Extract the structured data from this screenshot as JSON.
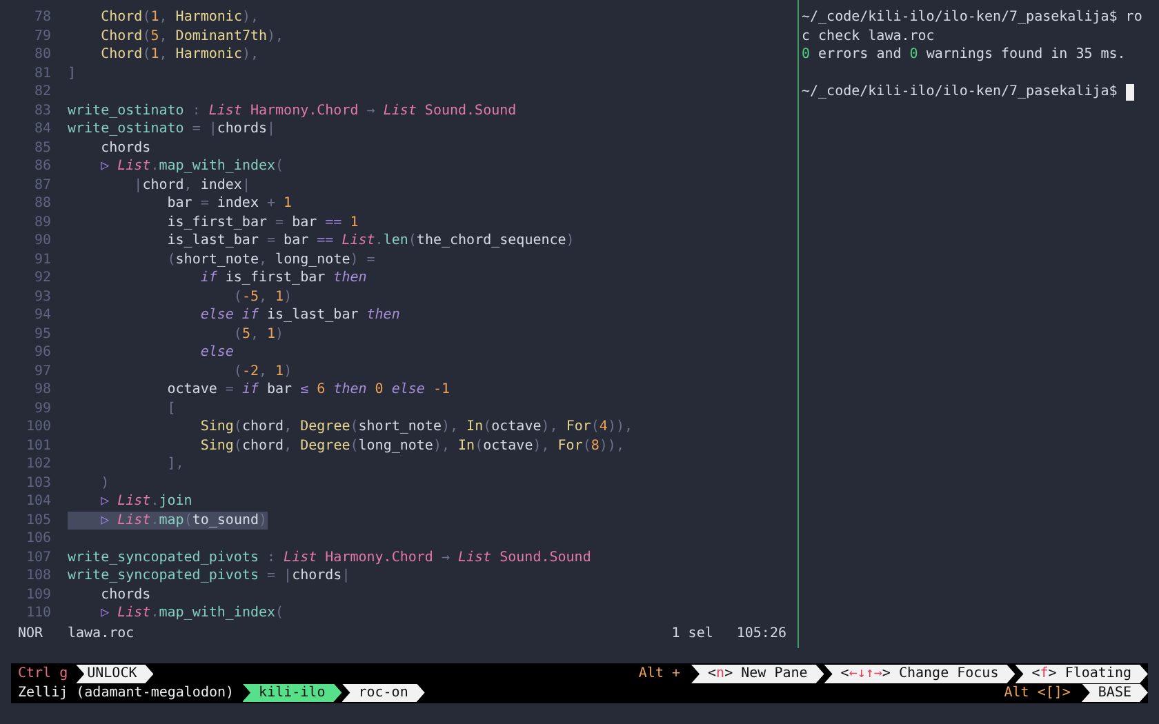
{
  "editor": {
    "lines": [
      {
        "number": "78",
        "selected": false,
        "tokens": [
          {
            "text": "    Chord",
            "kind": "c"
          },
          {
            "text": "(",
            "kind": "x"
          },
          {
            "text": "1",
            "kind": "n"
          },
          {
            "text": ", ",
            "kind": "x"
          },
          {
            "text": "Harmonic",
            "kind": "c"
          },
          {
            "text": "),",
            "kind": "x"
          }
        ]
      },
      {
        "number": "79",
        "selected": false,
        "tokens": [
          {
            "text": "    Chord",
            "kind": "c"
          },
          {
            "text": "(",
            "kind": "x"
          },
          {
            "text": "5",
            "kind": "n"
          },
          {
            "text": ", ",
            "kind": "x"
          },
          {
            "text": "Dominant7th",
            "kind": "c"
          },
          {
            "text": "),",
            "kind": "x"
          }
        ]
      },
      {
        "number": "80",
        "selected": false,
        "tokens": [
          {
            "text": "    Chord",
            "kind": "c"
          },
          {
            "text": "(",
            "kind": "x"
          },
          {
            "text": "1",
            "kind": "n"
          },
          {
            "text": ", ",
            "kind": "x"
          },
          {
            "text": "Harmonic",
            "kind": "c"
          },
          {
            "text": "),",
            "kind": "x"
          }
        ]
      },
      {
        "number": "81",
        "selected": false,
        "tokens": [
          {
            "text": "]",
            "kind": "x"
          }
        ]
      },
      {
        "number": "82",
        "selected": false
      },
      {
        "number": "83",
        "selected": false,
        "tokens": [
          {
            "text": "write_ostinato",
            "kind": "f"
          },
          {
            "text": " : ",
            "kind": "x"
          },
          {
            "text": "List",
            "kind": "ti"
          },
          {
            "text": " Harmony.Chord ",
            "kind": "t"
          },
          {
            "text": "→ ",
            "kind": "x"
          },
          {
            "text": "List",
            "kind": "ti"
          },
          {
            "text": " Sound.Sound",
            "kind": "t"
          }
        ]
      },
      {
        "number": "84",
        "selected": false,
        "tokens": [
          {
            "text": "write_ostinato",
            "kind": "f"
          },
          {
            "text": " = |",
            "kind": "x"
          },
          {
            "text": "chords",
            "kind": "p"
          },
          {
            "text": "|",
            "kind": "x"
          }
        ]
      },
      {
        "number": "85",
        "selected": false,
        "tokens": [
          {
            "text": "    chords",
            "kind": "p"
          }
        ]
      },
      {
        "number": "86",
        "selected": false,
        "tokens": [
          {
            "text": "    ▷ ",
            "kind": "o"
          },
          {
            "text": "List",
            "kind": "ti"
          },
          {
            "text": ".",
            "kind": "x"
          },
          {
            "text": "map_with_index",
            "kind": "f"
          },
          {
            "text": "(",
            "kind": "x"
          }
        ]
      },
      {
        "number": "87",
        "selected": false,
        "tokens": [
          {
            "text": "        |",
            "kind": "x"
          },
          {
            "text": "chord",
            "kind": "p"
          },
          {
            "text": ", ",
            "kind": "x"
          },
          {
            "text": "index",
            "kind": "p"
          },
          {
            "text": "|",
            "kind": "x"
          }
        ]
      },
      {
        "number": "88",
        "selected": false,
        "tokens": [
          {
            "text": "            bar",
            "kind": "p"
          },
          {
            "text": " = ",
            "kind": "x"
          },
          {
            "text": "index ",
            "kind": "p"
          },
          {
            "text": "+ ",
            "kind": "x"
          },
          {
            "text": "1",
            "kind": "n"
          }
        ]
      },
      {
        "number": "89",
        "selected": false,
        "tokens": [
          {
            "text": "            is_first_bar",
            "kind": "p"
          },
          {
            "text": " = ",
            "kind": "x"
          },
          {
            "text": "bar ",
            "kind": "p"
          },
          {
            "text": "== ",
            "kind": "o"
          },
          {
            "text": "1",
            "kind": "n"
          }
        ]
      },
      {
        "number": "90",
        "selected": false,
        "tokens": [
          {
            "text": "            is_last_bar",
            "kind": "p"
          },
          {
            "text": " = ",
            "kind": "x"
          },
          {
            "text": "bar ",
            "kind": "p"
          },
          {
            "text": "== ",
            "kind": "o"
          },
          {
            "text": "List",
            "kind": "ti"
          },
          {
            "text": ".",
            "kind": "x"
          },
          {
            "text": "len",
            "kind": "f"
          },
          {
            "text": "(",
            "kind": "x"
          },
          {
            "text": "the_chord_sequence",
            "kind": "p"
          },
          {
            "text": ")",
            "kind": "x"
          }
        ]
      },
      {
        "number": "91",
        "selected": false,
        "tokens": [
          {
            "text": "            (",
            "kind": "x"
          },
          {
            "text": "short_note",
            "kind": "p"
          },
          {
            "text": ", ",
            "kind": "x"
          },
          {
            "text": "long_note",
            "kind": "p"
          },
          {
            "text": ") =",
            "kind": "x"
          }
        ]
      },
      {
        "number": "92",
        "selected": false,
        "tokens": [
          {
            "text": "                if",
            "kind": "k"
          },
          {
            "text": " is_first_bar ",
            "kind": "p"
          },
          {
            "text": "then",
            "kind": "k"
          }
        ]
      },
      {
        "number": "93",
        "selected": false,
        "tokens": [
          {
            "text": "                    (",
            "kind": "x"
          },
          {
            "text": "-5",
            "kind": "n"
          },
          {
            "text": ", ",
            "kind": "x"
          },
          {
            "text": "1",
            "kind": "n"
          },
          {
            "text": ")",
            "kind": "x"
          }
        ]
      },
      {
        "number": "94",
        "selected": false,
        "tokens": [
          {
            "text": "                else if",
            "kind": "k"
          },
          {
            "text": " is_last_bar ",
            "kind": "p"
          },
          {
            "text": "then",
            "kind": "k"
          }
        ]
      },
      {
        "number": "95",
        "selected": false,
        "tokens": [
          {
            "text": "                    (",
            "kind": "x"
          },
          {
            "text": "5",
            "kind": "n"
          },
          {
            "text": ", ",
            "kind": "x"
          },
          {
            "text": "1",
            "kind": "n"
          },
          {
            "text": ")",
            "kind": "x"
          }
        ]
      },
      {
        "number": "96",
        "selected": false,
        "tokens": [
          {
            "text": "                else",
            "kind": "k"
          }
        ]
      },
      {
        "number": "97",
        "selected": false,
        "tokens": [
          {
            "text": "                    (",
            "kind": "x"
          },
          {
            "text": "-2",
            "kind": "n"
          },
          {
            "text": ", ",
            "kind": "x"
          },
          {
            "text": "1",
            "kind": "n"
          },
          {
            "text": ")",
            "kind": "x"
          }
        ]
      },
      {
        "number": "98",
        "selected": false,
        "tokens": [
          {
            "text": "            octave",
            "kind": "p"
          },
          {
            "text": " = ",
            "kind": "x"
          },
          {
            "text": "if",
            "kind": "k"
          },
          {
            "text": " bar ",
            "kind": "p"
          },
          {
            "text": "≤ ",
            "kind": "o"
          },
          {
            "text": "6 ",
            "kind": "n"
          },
          {
            "text": "then",
            "kind": "k"
          },
          {
            "text": " 0 ",
            "kind": "n"
          },
          {
            "text": "else",
            "kind": "k"
          },
          {
            "text": " -1",
            "kind": "n"
          }
        ]
      },
      {
        "number": "99",
        "selected": false,
        "tokens": [
          {
            "text": "            [",
            "kind": "x"
          }
        ]
      },
      {
        "number": "100",
        "selected": false,
        "tokens": [
          {
            "text": "                Sing",
            "kind": "c"
          },
          {
            "text": "(",
            "kind": "x"
          },
          {
            "text": "chord",
            "kind": "p"
          },
          {
            "text": ", ",
            "kind": "x"
          },
          {
            "text": "Degree",
            "kind": "c"
          },
          {
            "text": "(",
            "kind": "x"
          },
          {
            "text": "short_note",
            "kind": "p"
          },
          {
            "text": "), ",
            "kind": "x"
          },
          {
            "text": "In",
            "kind": "c"
          },
          {
            "text": "(",
            "kind": "x"
          },
          {
            "text": "octave",
            "kind": "p"
          },
          {
            "text": "), ",
            "kind": "x"
          },
          {
            "text": "For",
            "kind": "c"
          },
          {
            "text": "(",
            "kind": "x"
          },
          {
            "text": "4",
            "kind": "n"
          },
          {
            "text": ")),",
            "kind": "x"
          }
        ]
      },
      {
        "number": "101",
        "selected": false,
        "tokens": [
          {
            "text": "                Sing",
            "kind": "c"
          },
          {
            "text": "(",
            "kind": "x"
          },
          {
            "text": "chord",
            "kind": "p"
          },
          {
            "text": ", ",
            "kind": "x"
          },
          {
            "text": "Degree",
            "kind": "c"
          },
          {
            "text": "(",
            "kind": "x"
          },
          {
            "text": "long_note",
            "kind": "p"
          },
          {
            "text": "), ",
            "kind": "x"
          },
          {
            "text": "In",
            "kind": "c"
          },
          {
            "text": "(",
            "kind": "x"
          },
          {
            "text": "octave",
            "kind": "p"
          },
          {
            "text": "), ",
            "kind": "x"
          },
          {
            "text": "For",
            "kind": "c"
          },
          {
            "text": "(",
            "kind": "x"
          },
          {
            "text": "8",
            "kind": "n"
          },
          {
            "text": ")),",
            "kind": "x"
          }
        ]
      },
      {
        "number": "102",
        "selected": false,
        "tokens": [
          {
            "text": "            ],",
            "kind": "x"
          }
        ]
      },
      {
        "number": "103",
        "selected": false,
        "tokens": [
          {
            "text": "    )",
            "kind": "x"
          }
        ]
      },
      {
        "number": "104",
        "selected": false,
        "tokens": [
          {
            "text": "    ▷ ",
            "kind": "o"
          },
          {
            "text": "List",
            "kind": "ti"
          },
          {
            "text": ".",
            "kind": "x"
          },
          {
            "text": "join",
            "kind": "f"
          }
        ]
      },
      {
        "number": "105",
        "selected": true,
        "tokens": [
          {
            "text": "    ▷ ",
            "kind": "o"
          },
          {
            "text": "List",
            "kind": "ti"
          },
          {
            "text": ".",
            "kind": "x"
          },
          {
            "text": "map",
            "kind": "f"
          },
          {
            "text": "(",
            "kind": "x"
          },
          {
            "text": "to_sound",
            "kind": "p"
          },
          {
            "text": ")",
            "kind": "x"
          }
        ]
      },
      {
        "number": "106",
        "selected": false
      },
      {
        "number": "107",
        "selected": false,
        "tokens": [
          {
            "text": "write_syncopated_pivots",
            "kind": "f"
          },
          {
            "text": " : ",
            "kind": "x"
          },
          {
            "text": "List",
            "kind": "ti"
          },
          {
            "text": " Harmony.Chord ",
            "kind": "t"
          },
          {
            "text": "→ ",
            "kind": "x"
          },
          {
            "text": "List",
            "kind": "ti"
          },
          {
            "text": " Sound.Sound",
            "kind": "t"
          }
        ]
      },
      {
        "number": "108",
        "selected": false,
        "tokens": [
          {
            "text": "write_syncopated_pivots",
            "kind": "f"
          },
          {
            "text": " = |",
            "kind": "x"
          },
          {
            "text": "chords",
            "kind": "p"
          },
          {
            "text": "|",
            "kind": "x"
          }
        ]
      },
      {
        "number": "109",
        "selected": false,
        "tokens": [
          {
            "text": "    chords",
            "kind": "p"
          }
        ]
      },
      {
        "number": "110",
        "selected": false,
        "tokens": [
          {
            "text": "    ▷ ",
            "kind": "o"
          },
          {
            "text": "List",
            "kind": "ti"
          },
          {
            "text": ".",
            "kind": "x"
          },
          {
            "text": "map_with_index",
            "kind": "f"
          },
          {
            "text": "(",
            "kind": "x"
          }
        ]
      }
    ],
    "status_line": {
      "mode": "NOR",
      "file": "lawa.roc",
      "selection": "1 sel",
      "position": "105:26"
    }
  },
  "terminal": {
    "lines": [
      {
        "cursor": false,
        "tokens": [
          {
            "text": "~/_code/kili-ilo/ilo-ken/7_pasekalija$ ro",
            "kind": "p"
          }
        ]
      },
      {
        "cursor": false,
        "tokens": [
          {
            "text": "c check lawa.roc",
            "kind": "p"
          }
        ]
      },
      {
        "cursor": false,
        "tokens": [
          {
            "text": "0",
            "kind": "g"
          },
          {
            "text": " errors and ",
            "kind": "p"
          },
          {
            "text": "0",
            "kind": "g"
          },
          {
            "text": " warnings found in 35 ms.",
            "kind": "p"
          }
        ]
      },
      {
        "cursor": false
      },
      {
        "cursor": true,
        "tokens": [
          {
            "text": "~/_code/kili-ilo/ilo-ken/7_pasekalija$",
            "kind": "p"
          }
        ]
      }
    ]
  },
  "zellij_bar": {
    "lock_key": "Ctrl g",
    "lock_mode": "UNLOCK",
    "modifier": "Alt +",
    "hints": [
      [
        {
          "text": "<",
          "kind": "p"
        },
        {
          "text": "n",
          "kind": "key"
        },
        {
          "text": "> New Pane",
          "kind": "p"
        }
      ],
      [
        {
          "text": "<",
          "kind": "p"
        },
        {
          "text": "←↓↑→",
          "kind": "key"
        },
        {
          "text": "> Change Focus",
          "kind": "p"
        }
      ],
      [
        {
          "text": "<",
          "kind": "p"
        },
        {
          "text": "f",
          "kind": "key"
        },
        {
          "text": "> Floating",
          "kind": "p"
        }
      ]
    ],
    "session": "Zellij (adamant-megalodon)",
    "tabs": [
      {
        "label": "kili-ilo",
        "selected": true
      },
      {
        "label": "roc-on",
        "selected": false
      }
    ],
    "layout_key": "Alt <[]>",
    "layout": "BASE"
  }
}
